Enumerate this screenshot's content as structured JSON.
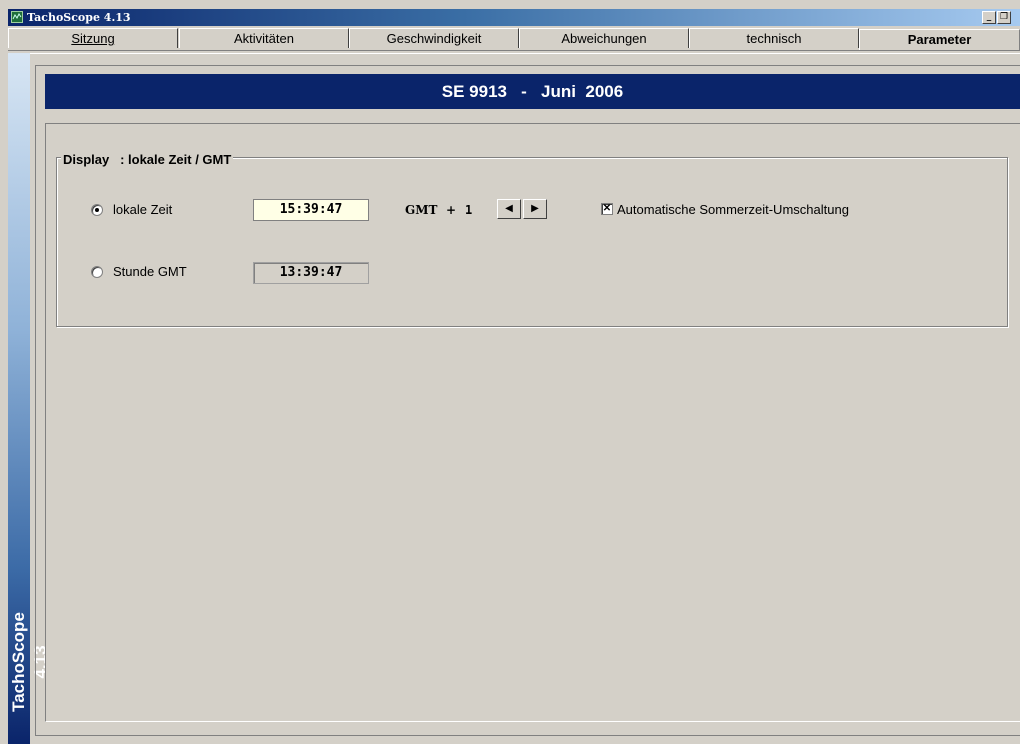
{
  "window": {
    "title": "TachoScope 4.13",
    "minimize_glyph": "_",
    "restore_glyph": "❐"
  },
  "tabs": [
    {
      "label": "Sitzung",
      "active": false
    },
    {
      "label": "Aktivitäten",
      "active": false
    },
    {
      "label": "Geschwindigkeit",
      "active": false
    },
    {
      "label": "Abweichungen",
      "active": false
    },
    {
      "label": "technisch",
      "active": false
    },
    {
      "label": "Parameter",
      "active": true
    }
  ],
  "sidebar": {
    "label": "TachoScope 4.13"
  },
  "header": {
    "title": "SE 9913   -   Juni  2006"
  },
  "display_group": {
    "legend": "Display   : lokale Zeit / GMT",
    "local_time": {
      "label": "lokale Zeit",
      "value": "15:39:47",
      "selected": true
    },
    "gmt_time": {
      "label": "Stunde GMT",
      "value": "13:39:47",
      "selected": false
    },
    "gmt_offset": {
      "prefix": "GMT",
      "sign": "+",
      "value": "1"
    },
    "auto_dst": {
      "label": "Automatische Sommerzeit-Umschaltung",
      "checked": true
    }
  },
  "colors": {
    "header_bg": "#0a246a",
    "window_bg": "#d4d0c8",
    "editable_field_bg": "#ffffe6"
  }
}
